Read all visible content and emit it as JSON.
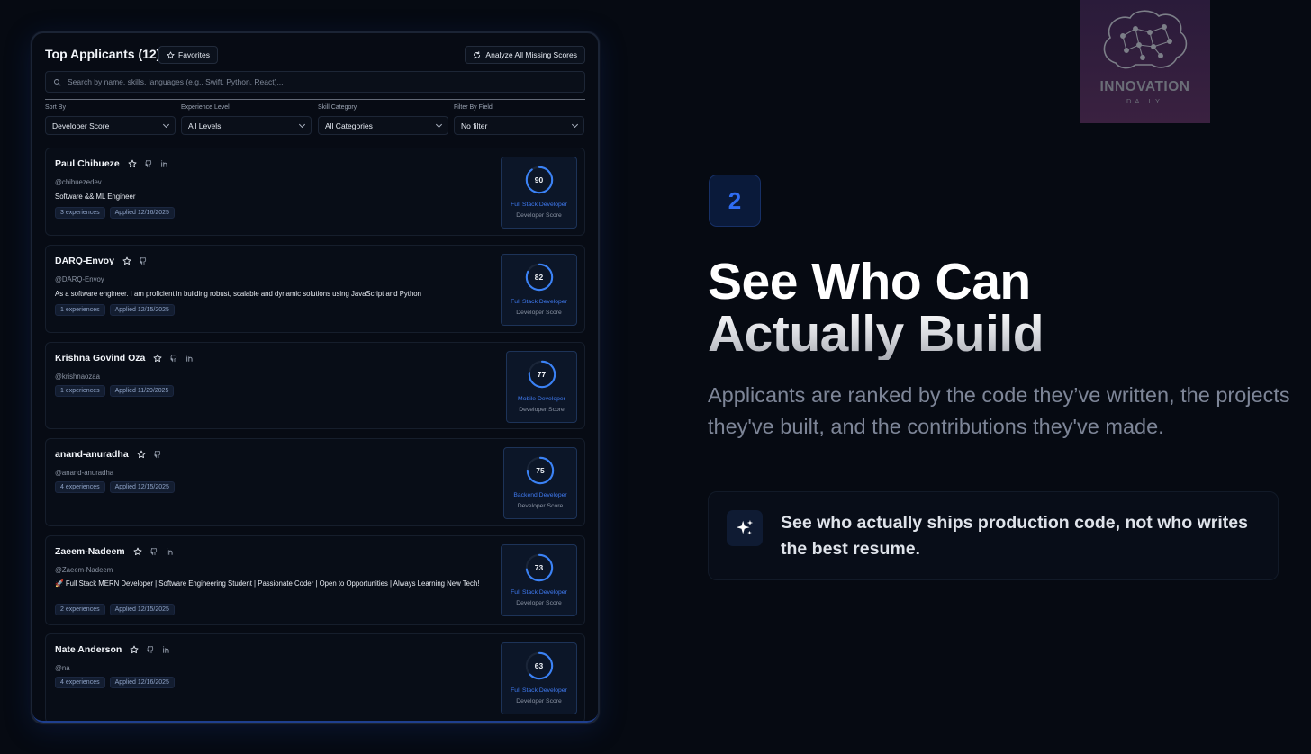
{
  "app": {
    "title": "Top Applicants (12)",
    "favorites_label": "Favorites",
    "analyze_label": "Analyze All Missing Scores",
    "search_placeholder": "Search by name, skills, languages (e.g., Swift, Python, React)..."
  },
  "filters": [
    {
      "label": "Sort By",
      "value": "Developer Score"
    },
    {
      "label": "Experience Level",
      "value": "All Levels"
    },
    {
      "label": "Skill Category",
      "value": "All Categories"
    },
    {
      "label": "Filter By Field",
      "value": "No filter"
    }
  ],
  "applicants": [
    {
      "name": "Paul Chibueze",
      "handle": "@chibuezedev",
      "bio": "Software && ML Engineer",
      "experiences": "3 experiences",
      "applied": "Applied 12/16/2025",
      "score": 90,
      "score_text": "90",
      "category": "Full Stack Developer",
      "score_label": "Developer Score",
      "icons": [
        "star-icon",
        "github-icon",
        "linkedin-icon"
      ]
    },
    {
      "name": "DARQ-Envoy",
      "handle": "@DARQ-Envoy",
      "bio": "As a software engineer. I am proficient in building robust, scalable and dynamic solutions using JavaScript and Python",
      "experiences": "1 experiences",
      "applied": "Applied 12/15/2025",
      "score": 82,
      "score_text": "82",
      "category": "Full Stack Developer",
      "score_label": "Developer Score",
      "icons": [
        "star-icon",
        "github-icon"
      ]
    },
    {
      "name": "Krishna Govind Oza",
      "handle": "@krishnaozaa",
      "bio": "",
      "experiences": "1 experiences",
      "applied": "Applied 11/29/2025",
      "score": 77,
      "score_text": "77",
      "category": "Mobile Developer",
      "score_label": "Developer Score",
      "icons": [
        "star-icon",
        "github-icon",
        "linkedin-icon"
      ]
    },
    {
      "name": "anand-anuradha",
      "handle": "@anand-anuradha",
      "bio": "",
      "experiences": "4 experiences",
      "applied": "Applied 12/15/2025",
      "score": 75,
      "score_text": "75",
      "category": "Backend Developer",
      "score_label": "Developer Score",
      "icons": [
        "star-icon",
        "github-icon"
      ]
    },
    {
      "name": "Zaeem-Nadeem",
      "handle": "@Zaeem-Nadeem",
      "bio": "🚀 Full Stack MERN Developer | Software Engineering Student | Passionate Coder | Open to Opportunities | Always Learning New Tech!",
      "experiences": "2 experiences",
      "applied": "Applied 12/15/2025",
      "score": 73,
      "score_text": "73",
      "category": "Full Stack Developer",
      "score_label": "Developer Score",
      "icons": [
        "star-icon",
        "github-icon",
        "linkedin-icon"
      ]
    },
    {
      "name": "Nate Anderson",
      "handle": "@na",
      "bio": "",
      "experiences": "4 experiences",
      "applied": "Applied 12/16/2025",
      "score": 63,
      "score_text": "63",
      "category": "Full Stack Developer",
      "score_label": "Developer Score",
      "icons": [
        "star-icon",
        "github-icon",
        "linkedin-icon"
      ]
    }
  ],
  "logo": {
    "line1": "INNOVATION",
    "line2": "DAILY"
  },
  "marketing": {
    "step": "2",
    "headline_line1": "See Who Can",
    "headline_line2": "Actually Build",
    "description": "Applicants are ranked by the code they’ve written, the projects they've built, and the contributions they've made.",
    "callout": "See who actually ships production code, not who writes the best resume."
  },
  "colors": {
    "accent": "#2f6cf2",
    "ring": "#3b82f6",
    "background": "#060a12"
  }
}
